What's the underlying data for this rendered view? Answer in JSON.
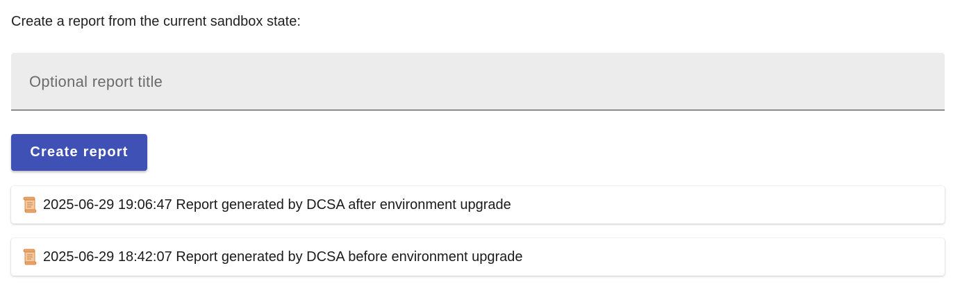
{
  "intro_text": "Create a report from the current sandbox state:",
  "title_field": {
    "placeholder": "Optional report title",
    "value": ""
  },
  "create_button": {
    "label": "Create report",
    "color": "#3f51b5"
  },
  "reports": [
    {
      "icon": "scroll-icon",
      "label": "2025-06-29 19:06:47 Report generated by DCSA after environment upgrade"
    },
    {
      "icon": "scroll-icon",
      "label": "2025-06-29 18:42:07 Report generated by DCSA before environment upgrade"
    }
  ]
}
